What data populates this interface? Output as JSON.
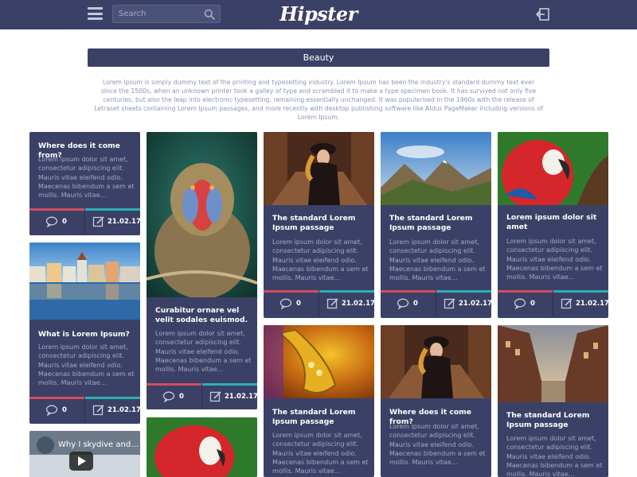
{
  "header": {
    "logo": "Hipster",
    "search_placeholder": "Search"
  },
  "category": "Beauty",
  "intro": "Lorem Ipsum is simply dummy text of the printing and typesetting industry. Lorem Ipsum has been the industry's standard dummy text ever since the 1500s, when an unknown printer took a galley of type and scrambled it to make a type specimen book. It has survived not only five centuries, but also the leap into electronic typesetting, remaining essentially unchanged. It was popularised in the 1960s with the release of Letraset sheets containing Lorem Ipsum passages, and more recently with desktop publishing software like Aldus PageMaker including versions of Lorem Ipsum.",
  "cards": [
    {
      "title": "Where does it come from?",
      "body": "Lorem ipsum dolor sit amet, consectetur adipiscing elit. Mauris vitae eleifend odio. Maecenas bibendum a sem et mollis. Mauris vitae…",
      "comments": "0",
      "date": "21.02.17"
    },
    {
      "title": "What is Lorem Ipsum?",
      "body": "Lorem ipsum dolor sit amet, consectetur adipiscing elit. Mauris vitae eleifend odio. Maecenas bibendum a sem et mollis. Mauris vitae…",
      "comments": "0",
      "date": "21.02.17"
    },
    {
      "title": "Curabitur ornare vel velit sodales euismod.",
      "body": "Lorem ipsum dolor sit amet, consectetur adipiscing elit. Mauris vitae eleifend odio. Maecenas bibendum a sem et mollis. Mauris vitae…",
      "comments": "0",
      "date": "21.02.17"
    },
    {
      "title": "The standard Lorem Ipsum passage",
      "body": "Lorem ipsum dolor sit amet, consectetur adipiscing elit. Mauris vitae eleifend odio. Maecenas bibendum a sem et mollis. Mauris vitae…",
      "comments": "0",
      "date": "21.02.17"
    },
    {
      "title": "The standard Lorem Ipsum passage",
      "body": "Lorem ipsum dolor sit amet, consectetur adipiscing elit. Mauris vitae eleifend odio. Maecenas bibendum a sem et mollis. Mauris vitae…",
      "comments": "0",
      "date": "21.02.17"
    },
    {
      "title": "Lorem ipsum dolor sit amet",
      "body": "Lorem ipsum dolor sit amet, consectetur adipiscing elit. Mauris vitae eleifend odio. Maecenas bibendum a sem et mollis. Mauris vitae…",
      "comments": "0",
      "date": "21.02.17"
    },
    {
      "title": "The standard Lorem Ipsum passage",
      "body": "Lorem ipsum dolor sit amet, consectetur adipiscing elit. Mauris vitae eleifend odio. Maecenas bibendum a sem et mollis. Mauris vitae…"
    },
    {
      "title": "Where does it come from?",
      "body": "Lorem ipsum dolor sit amet, consectetur adipiscing elit. Mauris vitae eleifend odio. Maecenas bibendum a sem et mollis. Mauris vitae…"
    },
    {
      "title": "The standard Lorem Ipsum passage",
      "body": "Lorem ipsum dolor sit amet, consectetur adipiscing elit. Mauris vitae eleifend odio. Maecenas bibendum a sem et mollis. Mauris vitae…"
    }
  ],
  "video": {
    "title": "Why I skydive and…"
  },
  "colors": {
    "navy": "#3b4166",
    "red_accent": "#d44d5c",
    "teal_accent": "#2ab0b6",
    "muted_text": "#8e94b8"
  }
}
